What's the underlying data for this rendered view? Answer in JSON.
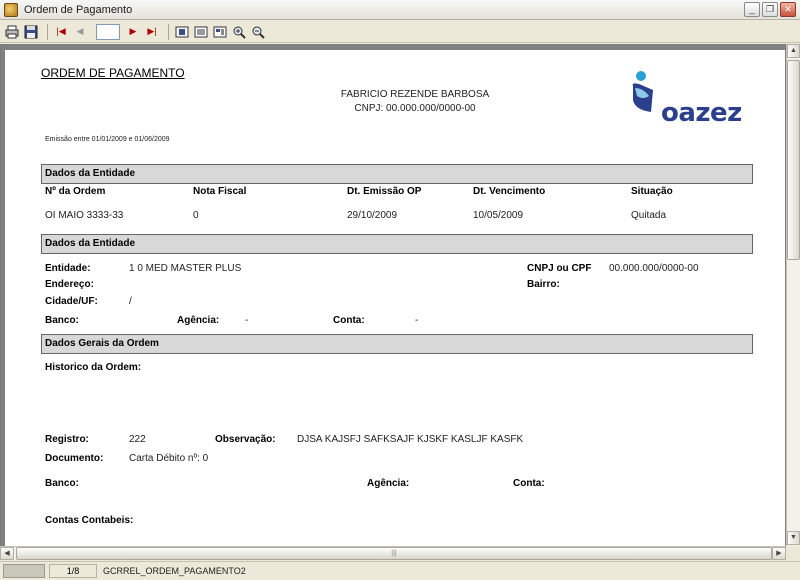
{
  "window": {
    "title": "Ordem de Pagamento"
  },
  "toolbar": {
    "page_value": ""
  },
  "report": {
    "title": "ORDEM DE PAGAMENTO",
    "company_name": "FABRICIO REZENDE BARBOSA",
    "company_cnpj": "CNPJ: 00.000.000/0000-00",
    "logo_text": "oazez",
    "emission": "Emissão entre 01/01/2009 e 01/06/2009",
    "section1": {
      "title": "Dados da Entidade",
      "headers": [
        "Nº da Ordem",
        "Nota Fiscal",
        "Dt. Emissão OP",
        "Dt. Vencimento",
        "Situação"
      ],
      "values": [
        "OI MAIO 3333-33",
        "0",
        "29/10/2009",
        "10/05/2009",
        "Quitada"
      ]
    },
    "section2": {
      "title": "Dados da Entidade",
      "entidade_label": "Entidade:",
      "entidade_value": "1 0  MED MASTER PLUS",
      "cnpj_label": "CNPJ ou CPF",
      "cnpj_value": "00.000.000/0000-00",
      "endereco_label": "Endereço:",
      "bairro_label": "Bairro:",
      "cidade_label": "Cidade/UF:",
      "cidade_value": "/",
      "banco_label": "Banco:",
      "agencia_label": "Agência:",
      "agencia_value": "-",
      "conta_label": "Conta:",
      "conta_value": "-"
    },
    "section3": {
      "title": "Dados Gerais da Ordem",
      "historico_label": "Historico da Ordem:",
      "registro_label": "Registro:",
      "registro_value": "222",
      "observacao_label": "Observação:",
      "observacao_value": "DJSA KAJSFJ SAFKSAJF KJSKF KASLJF KASFK",
      "documento_label": "Documento:",
      "documento_value": "Carta Débito nº: 0",
      "banco_label": "Banco:",
      "agencia_label": "Agência:",
      "conta_label": "Conta:",
      "contas_label": "Contas Contabeis:"
    }
  },
  "statusbar": {
    "page": "1/8",
    "report_name": "GCRREL_ORDEM_PAGAMENTO2"
  }
}
